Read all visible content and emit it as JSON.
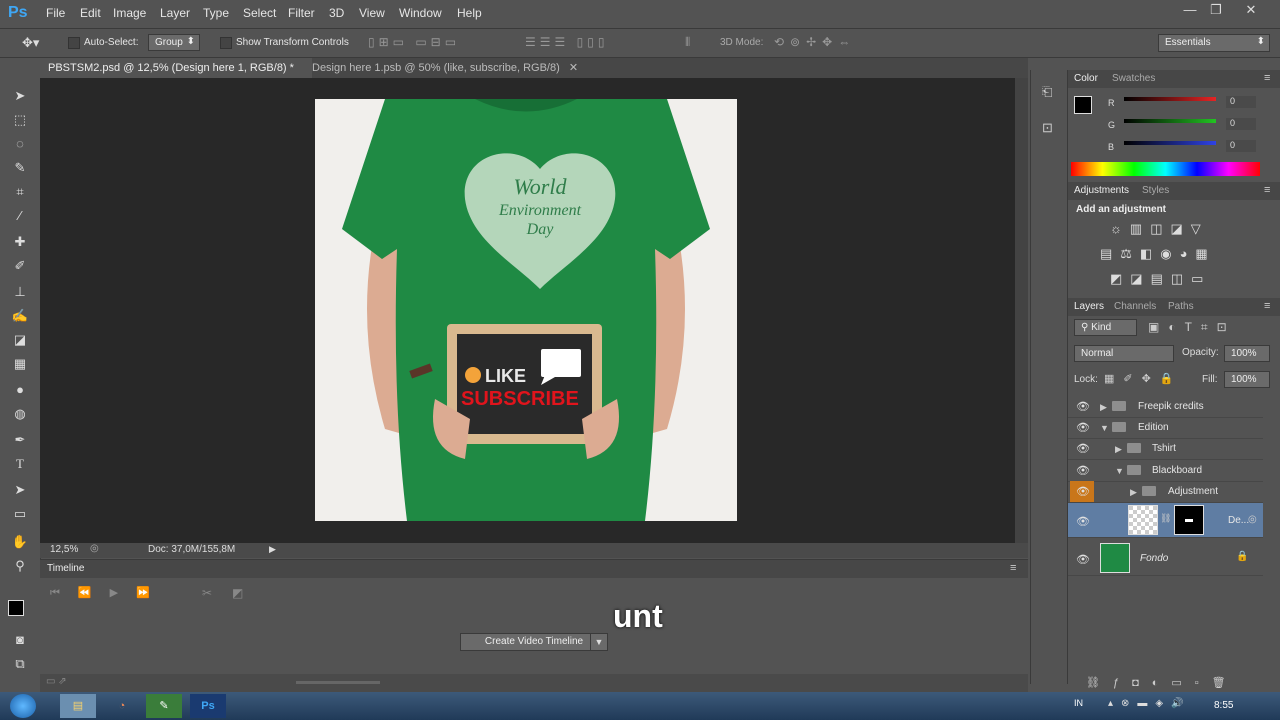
{
  "app": {
    "logo": "Ps"
  },
  "menu": [
    "File",
    "Edit",
    "Image",
    "Layer",
    "Type",
    "Select",
    "Filter",
    "3D",
    "View",
    "Window",
    "Help"
  ],
  "window_controls": {
    "minimize": "—",
    "restore": "❐",
    "close": "✕"
  },
  "options": {
    "auto_select_label": "Auto-Select:",
    "auto_select_value": "Group",
    "show_transform_label": "Show Transform Controls",
    "mode_3d_label": "3D Mode:",
    "workspace": "Essentials"
  },
  "tabs": [
    {
      "label": "PBSTSM2.psd @ 12,5% (Design here 1, RGB/8) *",
      "close": "✕"
    },
    {
      "label": "Design here 1.psb @ 50% (like, subscribe, RGB/8)",
      "close": "✕"
    }
  ],
  "status": {
    "zoom": "12,5%",
    "doc": "Doc: 37,0M/155,8M"
  },
  "artwork": {
    "shirt_text_1": "World",
    "shirt_text_2": "Environment",
    "shirt_text_3": "Day",
    "board_like": "LIKE",
    "board_subscribe": "SUBSCRIBE",
    "colors": {
      "shirt": "#1f8a44",
      "board": "#2a2a2a",
      "frame": "#d9b98f",
      "subscribe": "#e0141c"
    }
  },
  "timeline": {
    "title": "Timeline",
    "create_button": "Create Video Timeline"
  },
  "subtitle": "unt",
  "color_panel": {
    "tabs": [
      "Color",
      "Swatches"
    ],
    "channels": [
      {
        "name": "R",
        "value": "0",
        "color": "#e62424"
      },
      {
        "name": "G",
        "value": "0",
        "color": "#22c422"
      },
      {
        "name": "B",
        "value": "0",
        "color": "#2f43e6"
      }
    ]
  },
  "adjustments": {
    "tabs": [
      "Adjustments",
      "Styles"
    ],
    "title": "Add an adjustment"
  },
  "layers": {
    "tabs": [
      "Layers",
      "Channels",
      "Paths"
    ],
    "kind": "Kind",
    "blend": "Normal",
    "opacity_label": "Opacity:",
    "opacity": "100%",
    "lock_label": "Lock:",
    "fill_label": "Fill:",
    "fill": "100%",
    "items": [
      {
        "name": "Freepik credits"
      },
      {
        "name": "Edition"
      },
      {
        "name": "Tshirt"
      },
      {
        "name": "Blackboard"
      },
      {
        "name": "Adjustment"
      },
      {
        "name": "De..."
      },
      {
        "name": "Fondo"
      }
    ]
  },
  "taskbar": {
    "lang": "IN",
    "time": "8:55"
  }
}
